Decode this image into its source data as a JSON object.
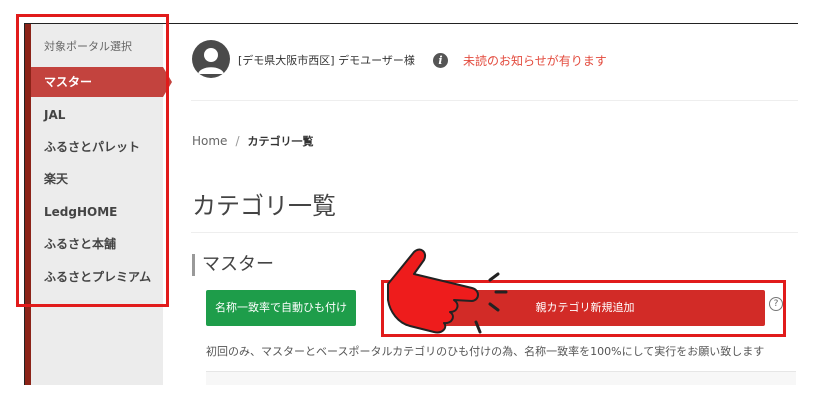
{
  "sidebar": {
    "title": "対象ポータル選択",
    "items": [
      {
        "label": "マスター",
        "active": true
      },
      {
        "label": "JAL",
        "active": false
      },
      {
        "label": "ふるさとパレット",
        "active": false
      },
      {
        "label": "楽天",
        "active": false
      },
      {
        "label": "LedgHOME",
        "active": false
      },
      {
        "label": "ふるさと本舗",
        "active": false
      },
      {
        "label": "ふるさとプレミアム",
        "active": false
      }
    ]
  },
  "header": {
    "user_name": "[デモ県大阪市西区] デモユーザー様",
    "notice": "未読のお知らせが有ります",
    "info_icon": "i"
  },
  "breadcrumb": {
    "home": "Home",
    "separator": "/",
    "current": "カテゴリ一覧"
  },
  "page": {
    "title": "カテゴリ一覧",
    "section_title": "マスター",
    "auto_link_button": "名称一致率で自動ひも付け",
    "add_parent_button": "親カテゴリ新規追加",
    "help_icon": "?",
    "help_note": "初回のみ、マスターとベースポータルカテゴリのひも付けの為、名称一致率を100%にして実行をお願い致します"
  },
  "colors": {
    "accent_red": "#c3433e",
    "button_green": "#1e9d4a",
    "button_red": "#d22b27",
    "notice_red": "#e34b3e",
    "highlight": "#e11b1b"
  }
}
